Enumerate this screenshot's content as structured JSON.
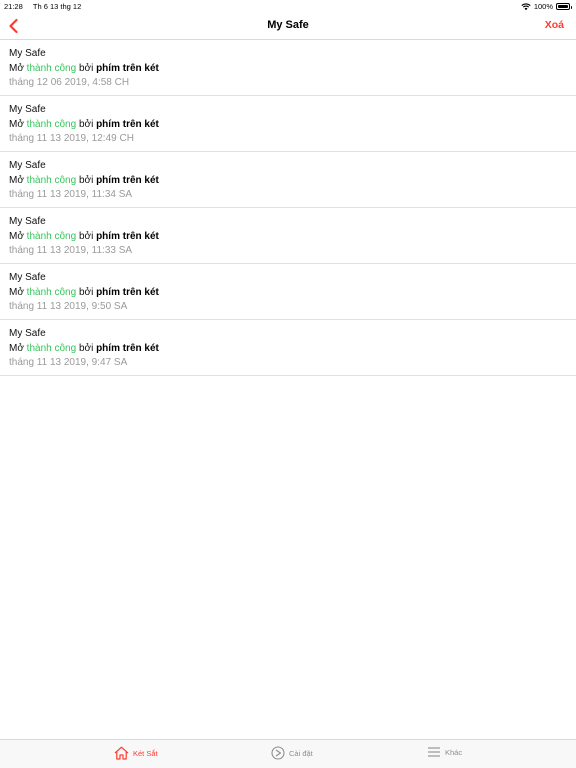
{
  "status_bar": {
    "time": "21:28",
    "date": "Th 6 13 thg 12",
    "battery": "100%"
  },
  "nav": {
    "title": "My Safe",
    "action_label": "Xoá"
  },
  "logs": [
    {
      "name": "My Safe",
      "prefix": "Mở ",
      "status": "thành công",
      "middle": " bởi ",
      "method": "phím trên két",
      "time": "tháng 12 06 2019, 4:58 CH"
    },
    {
      "name": "My Safe",
      "prefix": "Mở ",
      "status": "thành công",
      "middle": " bởi ",
      "method": "phím trên két",
      "time": "tháng 11 13 2019, 12:49 CH"
    },
    {
      "name": "My Safe",
      "prefix": "Mở ",
      "status": "thành công",
      "middle": " bởi ",
      "method": "phím trên két",
      "time": "tháng 11 13 2019, 11:34 SA"
    },
    {
      "name": "My Safe",
      "prefix": "Mở ",
      "status": "thành công",
      "middle": " bởi ",
      "method": "phím trên két",
      "time": "tháng 11 13 2019, 11:33 SA"
    },
    {
      "name": "My Safe",
      "prefix": "Mở ",
      "status": "thành công",
      "middle": " bởi ",
      "method": "phím trên két",
      "time": "tháng 11 13 2019, 9:50 SA"
    },
    {
      "name": "My Safe",
      "prefix": "Mở ",
      "status": "thành công",
      "middle": " bởi ",
      "method": "phím trên két",
      "time": "tháng 11 13 2019, 9:47 SA"
    }
  ],
  "tabs": [
    {
      "label": "Két Sắt",
      "icon": "home-icon",
      "active": true
    },
    {
      "label": "Cài đặt",
      "icon": "settings-icon",
      "active": false
    },
    {
      "label": "Khác",
      "icon": "menu-icon",
      "active": false
    }
  ],
  "colors": {
    "accent": "#ff3b30",
    "success": "#34c759",
    "muted": "#9a9a9a"
  }
}
